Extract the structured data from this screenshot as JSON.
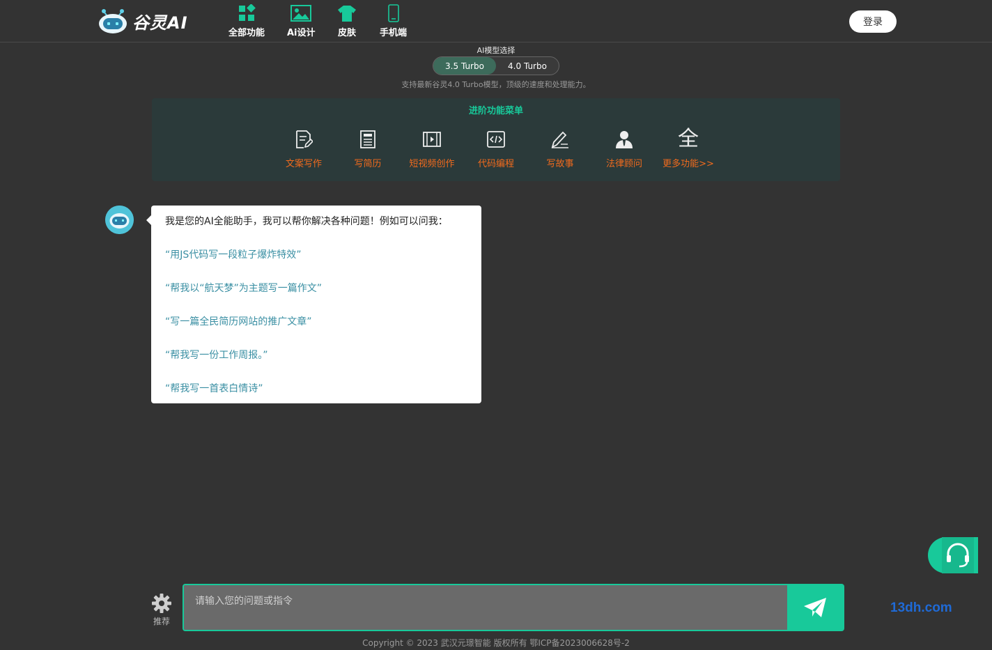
{
  "header": {
    "brand": "谷灵AI",
    "nav": [
      {
        "label": "全部功能",
        "icon": "grid-icon"
      },
      {
        "label": "Ai设计",
        "icon": "image-icon"
      },
      {
        "label": "皮肤",
        "icon": "shirt-icon"
      },
      {
        "label": "手机端",
        "icon": "phone-icon"
      }
    ],
    "login_label": "登录"
  },
  "model": {
    "title": "AI模型选择",
    "options": [
      "3.5 Turbo",
      "4.0 Turbo"
    ],
    "selected": "3.5 Turbo",
    "description": "支持最新谷灵4.0 Turbo模型，顶级的速度和处理能力。"
  },
  "advanced": {
    "title": "进阶功能菜单",
    "items": [
      {
        "label": "文案写作",
        "icon": "edit-doc-icon"
      },
      {
        "label": "写简历",
        "icon": "resume-icon"
      },
      {
        "label": "短视频创作",
        "icon": "video-icon"
      },
      {
        "label": "代码编程",
        "icon": "code-icon"
      },
      {
        "label": "写故事",
        "icon": "pen-icon"
      },
      {
        "label": "法律顾问",
        "icon": "lawyer-icon"
      },
      {
        "label": "更多功能>>",
        "icon": "all-icon",
        "glyph": "全"
      }
    ]
  },
  "chat": {
    "intro": "我是您的AI全能助手，我可以帮你解决各种问题！例如可以问我：",
    "examples": [
      "“用JS代码写一段粒子爆炸特效”",
      "“帮我以“航天梦”为主题写一篇作文”",
      "“写一篇全民简历网站的推广文章”",
      "“帮我写一份工作周报。”",
      "“帮我写一首表白情诗”"
    ]
  },
  "input": {
    "placeholder": "请输入您的问题或指令",
    "settings_label": "推荐"
  },
  "watermark": "13dh.com",
  "footer": "Copyright © 2023 武汉元璟智能 版权所有 鄂ICP备2023006628号-2",
  "colors": {
    "accent": "#18c99a",
    "orange": "#f26b1d",
    "bg": "#333333"
  }
}
